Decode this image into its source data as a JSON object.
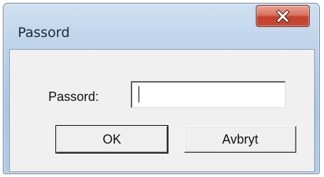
{
  "window": {
    "title": "Passord",
    "close_icon": "close-icon"
  },
  "form": {
    "password_label": "Passord:",
    "password_value": ""
  },
  "buttons": {
    "ok_label": "OK",
    "cancel_label": "Avbryt"
  },
  "colors": {
    "frame": "#bcd2ea",
    "close_button": "#c84a34",
    "client_bg": "#f0f0f0"
  }
}
